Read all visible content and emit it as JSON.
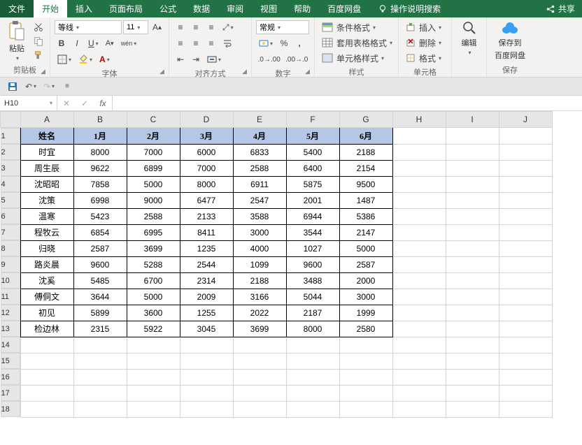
{
  "tabs": {
    "file": "文件",
    "start": "开始",
    "insert": "插入",
    "layout": "页面布局",
    "formula": "公式",
    "data": "数据",
    "review": "审阅",
    "view": "视图",
    "help": "帮助",
    "baidu": "百度网盘",
    "hint": "操作说明搜索",
    "share": "共享"
  },
  "ribbon": {
    "clipboard": {
      "paste": "粘贴",
      "label": "剪贴板"
    },
    "font": {
      "name": "等线",
      "size": "11",
      "label": "字体"
    },
    "align": {
      "label": "对齐方式"
    },
    "number": {
      "format": "常规",
      "label": "数字"
    },
    "styles": {
      "cond": "条件格式",
      "table": "套用表格格式",
      "cell": "单元格样式",
      "label": "样式"
    },
    "cells": {
      "insert": "插入",
      "delete": "删除",
      "format": "格式",
      "label": "单元格"
    },
    "editing": {
      "label": "编辑"
    },
    "save": {
      "top": "保存到",
      "bottom": "百度网盘",
      "label": "保存"
    }
  },
  "namebox": "H10",
  "chart_data": {
    "type": "table",
    "columns": [
      "姓名",
      "1月",
      "2月",
      "3月",
      "4月",
      "5月",
      "6月"
    ],
    "rows": [
      [
        "时宜",
        8000,
        7000,
        6000,
        6833,
        5400,
        2188
      ],
      [
        "周生辰",
        9622,
        6899,
        7000,
        2588,
        6400,
        2154
      ],
      [
        "沈昭昭",
        7858,
        5000,
        8000,
        6911,
        5875,
        9500
      ],
      [
        "沈策",
        6998,
        9000,
        6477,
        2547,
        2001,
        1487
      ],
      [
        "温寒",
        5423,
        2588,
        2133,
        3588,
        6944,
        5386
      ],
      [
        "程牧云",
        6854,
        6995,
        8411,
        3000,
        3544,
        2147
      ],
      [
        "归晓",
        2587,
        3699,
        1235,
        4000,
        1027,
        5000
      ],
      [
        "路炎晨",
        9600,
        5288,
        2544,
        1099,
        9600,
        2587
      ],
      [
        "沈奚",
        5485,
        6700,
        2314,
        2188,
        3488,
        2000
      ],
      [
        "傅侗文",
        3644,
        5000,
        2009,
        3166,
        5044,
        3000
      ],
      [
        "初见",
        5899,
        3600,
        1255,
        2022,
        2187,
        1999
      ],
      [
        "检边林",
        2315,
        5922,
        3045,
        3699,
        8000,
        2580
      ]
    ]
  },
  "colLetters": [
    "A",
    "B",
    "C",
    "D",
    "E",
    "F",
    "G",
    "H",
    "I",
    "J"
  ],
  "emptyRows": [
    14,
    15,
    16,
    17,
    18
  ]
}
